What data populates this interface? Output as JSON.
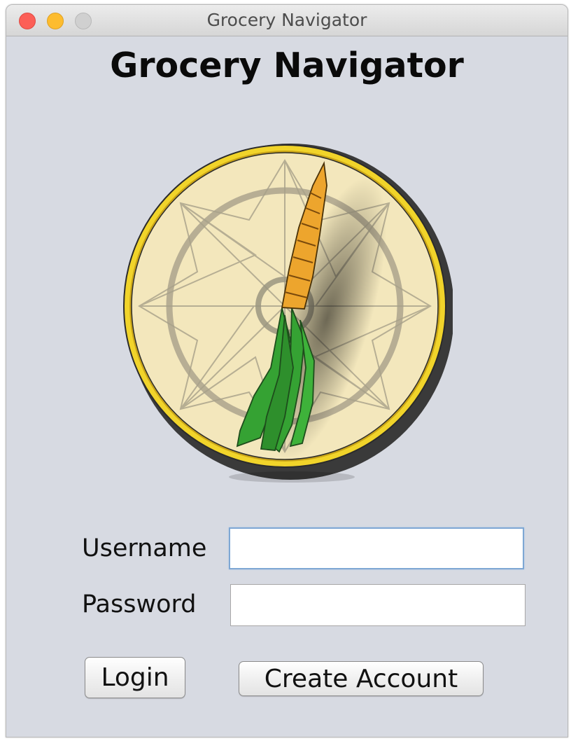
{
  "window": {
    "title": "Grocery Navigator"
  },
  "app": {
    "heading": "Grocery Navigator",
    "logo_icon": "compass-carrot-icon"
  },
  "form": {
    "username_label": "Username",
    "username_value": "",
    "password_label": "Password",
    "password_value": ""
  },
  "buttons": {
    "login": "Login",
    "create_account": "Create Account"
  },
  "colors": {
    "compass_rim": "#f1d42a",
    "compass_face": "#f3e7bc",
    "carrot": "#eda52d",
    "leaves": "#35a233",
    "focus_ring": "#7ea7d4"
  }
}
